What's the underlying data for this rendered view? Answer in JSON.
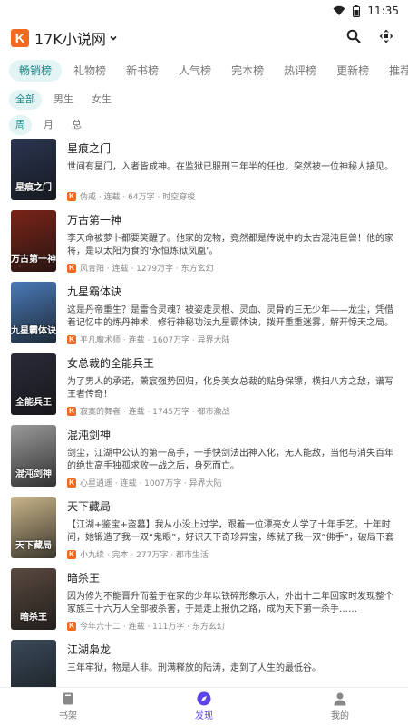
{
  "status": {
    "time": "11:35"
  },
  "header": {
    "title": "17K小说网",
    "logo_letter": "K"
  },
  "ranking_tabs": [
    "畅销榜",
    "礼物榜",
    "新书榜",
    "人气榜",
    "完本榜",
    "热评榜",
    "更新榜",
    "推荐票榜"
  ],
  "gender_filters": [
    "全部",
    "男生",
    "女生"
  ],
  "period_filters": [
    "周",
    "月",
    "总"
  ],
  "books": [
    {
      "title": "星痕之门",
      "desc": "世间有星门，入者皆成神。在监狱已服刑三年半的任也，突然被一位神秘人接见。",
      "author": "伪戒",
      "status": "连载",
      "words": "64万字",
      "genre": "时空穿梭",
      "cover_text": "星痕之门",
      "cover_color": "#2a3550"
    },
    {
      "title": "万古第一神",
      "desc": "李天命被萝卜都要笑醒了。他家的宠物，竟然都是传说中的太古混沌巨兽！他的家将，是以太阳为食的‘永恒炼狱凤凰’。",
      "author": "风青阳",
      "status": "连载",
      "words": "1279万字",
      "genre": "东方玄幻",
      "cover_text": "万古第一神",
      "cover_color": "#7a2418"
    },
    {
      "title": "九星霸体诀",
      "desc": "这是丹帝重生？是雷合灵魂？被姿走灵根、灵血、灵骨的三无少年——龙尘，凭借着记忆中的炼丹神术，修行神秘功法九星霸体诀，拨开重重迷雾，解开惊天之局。",
      "author": "平凡魔术师",
      "status": "连载",
      "words": "1607万字",
      "genre": "异界大陆",
      "cover_text": "九星霸体诀",
      "cover_color": "#4a7ab8"
    },
    {
      "title": "女总裁的全能兵王",
      "desc": "为了男人的承诺，萧宸强势回归，化身美女总裁的贴身保镖，横扫八方之敌，谱写王者传奇！",
      "author": "寂寞的舞者",
      "status": "连载",
      "words": "1745万字",
      "genre": "都市激战",
      "cover_text": "全能兵王",
      "cover_color": "#2b2b3a"
    },
    {
      "title": "混沌剑神",
      "desc": "剑尘，江湖中公认的第一高手，一手快剑法出神入化，无人能敌，当他与消失百年的绝世高手独孤求败一战之后，身死而亡。",
      "author": "心星逍遥",
      "status": "连载",
      "words": "1007万字",
      "genre": "异界大陆",
      "cover_text": "混沌剑神",
      "cover_color": "#9a9a9a"
    },
    {
      "title": "天下藏局",
      "desc": "【江湖+鉴宝+盗墓】我从小没上过学，跟着一位漂亮女人学了十年手艺。十年时间，她锻造了我一双“鬼眼”，好识天下奇珍异宝，练就了我一双“佛手”，破局下套横行无忌。教会我…",
      "author": "小九续",
      "status": "完本",
      "words": "277万字",
      "genre": "都市生活",
      "cover_text": "天下藏局",
      "cover_color": "#c9b58a"
    },
    {
      "title": "暗杀王",
      "desc": "因为修为不能晋升而羞于在家的少年以铁碎形象示人，外出十二年回家时发现整个家族三十六万人全部被杀害，于是走上报仇之路，成为天下第一杀手……",
      "author": "今年六十二",
      "status": "连载",
      "words": "111万字",
      "genre": "东方玄幻",
      "cover_text": "暗杀王",
      "cover_color": "#5a4a40"
    },
    {
      "title": "江湖枭龙",
      "desc": "三年牢狱，物是人非。刑满释放的陆涛，走到了人生的最低谷。",
      "author": "",
      "status": "",
      "words": "",
      "genre": "",
      "cover_text": "",
      "cover_color": "#3a4a5a"
    }
  ],
  "bottom_nav": [
    {
      "label": "书架",
      "icon": "bookshelf-icon"
    },
    {
      "label": "发现",
      "icon": "discover-icon"
    },
    {
      "label": "我的",
      "icon": "profile-icon"
    }
  ],
  "colors": {
    "accent": "#1a8a8a",
    "accent_bg": "#e3f4f4",
    "brand": "#f26a21",
    "nav_active": "#5b44e8"
  }
}
